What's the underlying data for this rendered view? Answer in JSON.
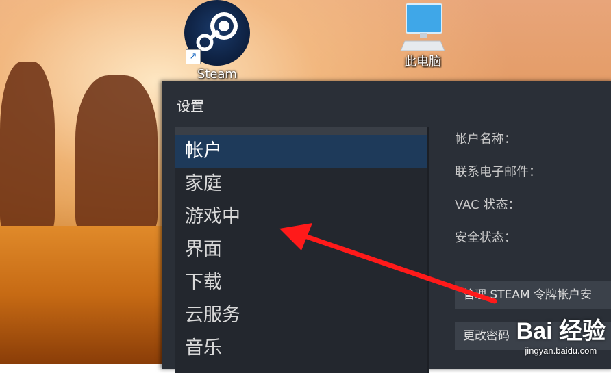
{
  "desktop": {
    "icons": [
      {
        "label": "Steam",
        "icon": "steam-icon"
      },
      {
        "label": "此电脑",
        "icon": "computer-icon"
      }
    ]
  },
  "window": {
    "title": "设置",
    "nav_items": [
      {
        "label": "帐户",
        "active": true
      },
      {
        "label": "家庭"
      },
      {
        "label": "游戏中"
      },
      {
        "label": "界面"
      },
      {
        "label": "下载"
      },
      {
        "label": "云服务"
      },
      {
        "label": "音乐"
      }
    ],
    "account_fields": [
      {
        "label": "帐户名称："
      },
      {
        "label": "联系电子邮件："
      },
      {
        "label": "VAC 状态："
      },
      {
        "label": "安全状态："
      }
    ],
    "buttons": [
      {
        "label": "管理 STEAM 令牌帐户安"
      },
      {
        "label": "更改密码"
      }
    ]
  },
  "annotation": {
    "arrow_color": "#ff1a1a",
    "points_to": "游戏中"
  },
  "watermark": {
    "logo": "Bai 经验",
    "url": "jingyan.baidu.com"
  },
  "colors": {
    "window_bg": "#2a2f37",
    "nav_active": "#1e3a5a",
    "accent_arrow": "#ff1a1a"
  }
}
